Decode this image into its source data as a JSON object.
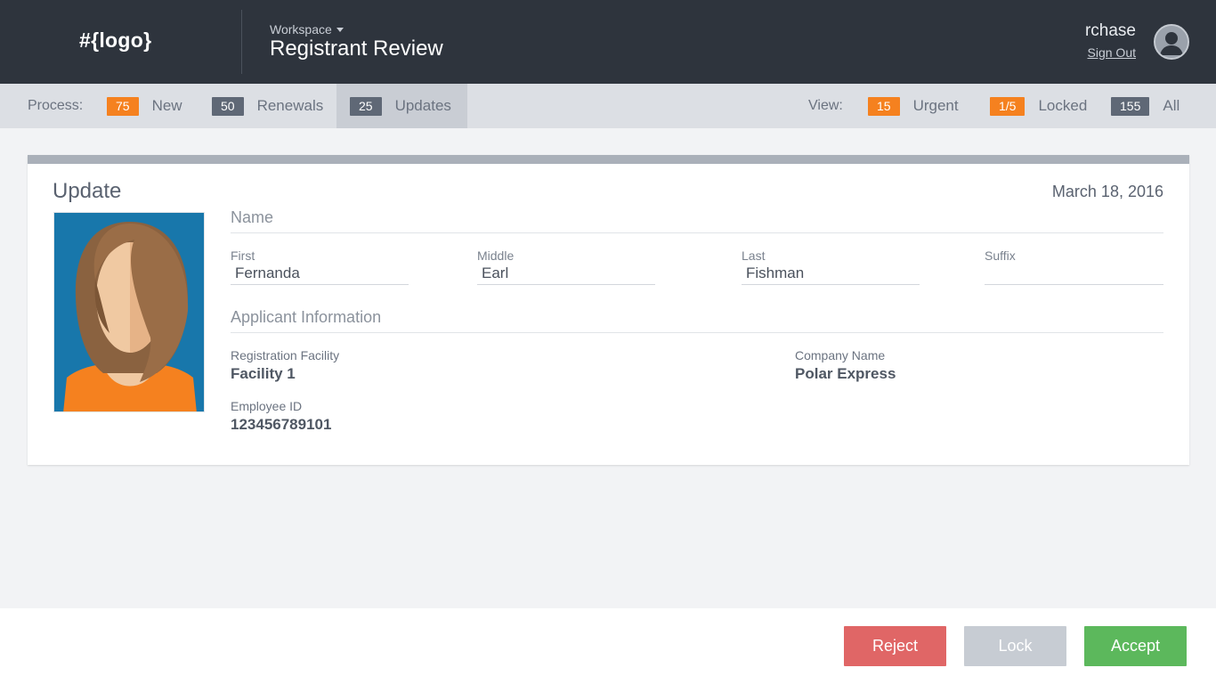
{
  "header": {
    "logo": "#{logo}",
    "workspace_label": "Workspace",
    "app_title": "Registrant Review",
    "username": "rchase",
    "sign_out": "Sign Out"
  },
  "subbar": {
    "process_label": "Process:",
    "process_items": [
      {
        "count": "75",
        "label": "New",
        "badge_color": "#f5811f"
      },
      {
        "count": "50",
        "label": "Renewals",
        "badge_color": "#5f6876"
      },
      {
        "count": "25",
        "label": "Updates",
        "badge_color": "#5f6876",
        "active": true
      }
    ],
    "view_label": "View:",
    "view_items": [
      {
        "count": "15",
        "label": "Urgent",
        "badge_color": "#f5811f"
      },
      {
        "count": "1/5",
        "label": "Locked",
        "badge_color": "#f5811f"
      },
      {
        "count": "155",
        "label": "All",
        "badge_color": "#5f6876"
      }
    ]
  },
  "card": {
    "title": "Update",
    "date": "March 18, 2016",
    "name_section": "Name",
    "name_fields": {
      "first": {
        "label": "First",
        "value": "Fernanda"
      },
      "middle": {
        "label": "Middle",
        "value": "Earl"
      },
      "last": {
        "label": "Last",
        "value": "Fishman"
      },
      "suffix": {
        "label": "Suffix",
        "value": ""
      }
    },
    "applicant_section": "Applicant Information",
    "applicant": {
      "facility": {
        "label": "Registration Facility",
        "value": "Facility 1"
      },
      "company": {
        "label": "Company Name",
        "value": "Polar Express"
      },
      "employee_id": {
        "label": "Employee ID",
        "value": "123456789101"
      }
    }
  },
  "footer": {
    "reject": "Reject",
    "lock": "Lock",
    "accept": "Accept"
  },
  "colors": {
    "header_bg": "#2e343d",
    "accent_orange": "#f5811f",
    "reject": "#e06666",
    "lock": "#c7ccd3",
    "accept": "#5cb85c"
  }
}
